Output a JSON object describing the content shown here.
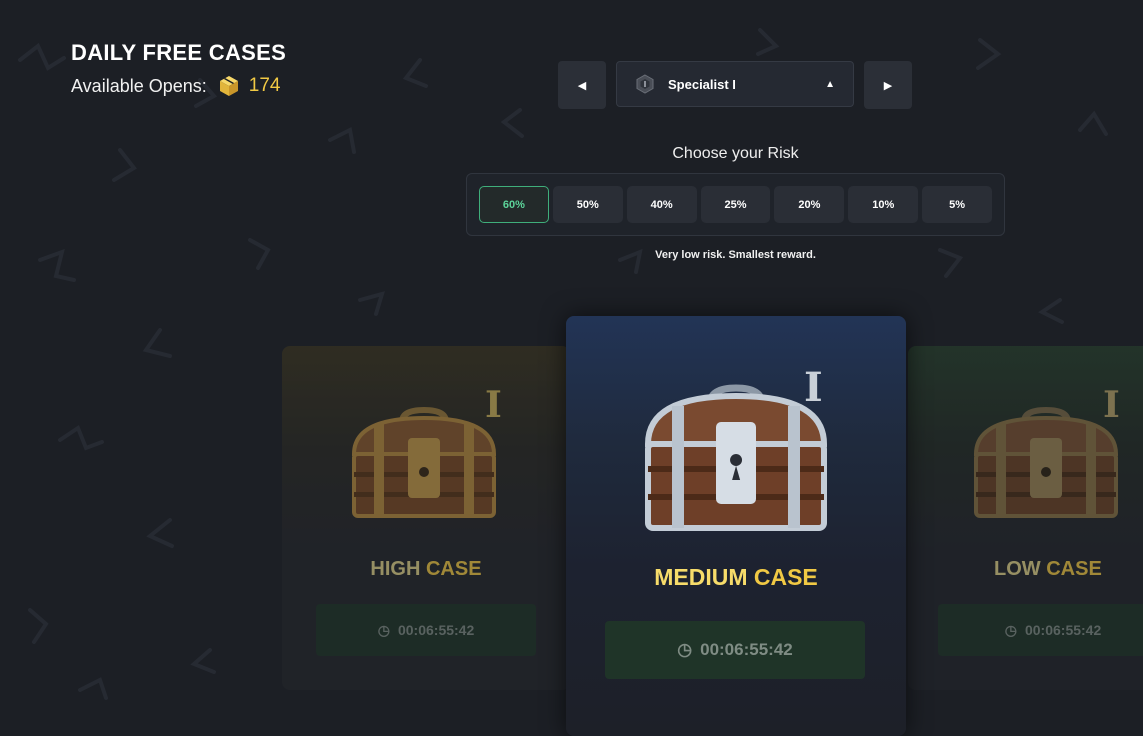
{
  "header": {
    "title": "DAILY FREE CASES",
    "available_label": "Available Opens:",
    "available_count": "174"
  },
  "rank": {
    "label": "Specialist I",
    "prev_icon": "triangle-left-icon",
    "next_icon": "triangle-right-icon"
  },
  "risk": {
    "title": "Choose your Risk",
    "options": [
      "60%",
      "50%",
      "40%",
      "25%",
      "20%",
      "10%",
      "5%"
    ],
    "selected": "60%",
    "description": "Very low risk. Smallest reward."
  },
  "cases": {
    "high": {
      "tier": "I",
      "name_part1": "HIGH",
      "name_part2": "CASE",
      "timer": "00:06:55:42"
    },
    "medium": {
      "tier": "I",
      "name_part1": "MEDIUM",
      "name_part2": "CASE",
      "timer": "00:06:55:42"
    },
    "low": {
      "tier": "I",
      "name_part1": "LOW",
      "name_part2": "CASE",
      "timer": "00:06:55:42"
    }
  },
  "colors": {
    "accent_gold": "#f1c944",
    "selected_risk": "#3fae7b",
    "background": "#1c1f25"
  }
}
